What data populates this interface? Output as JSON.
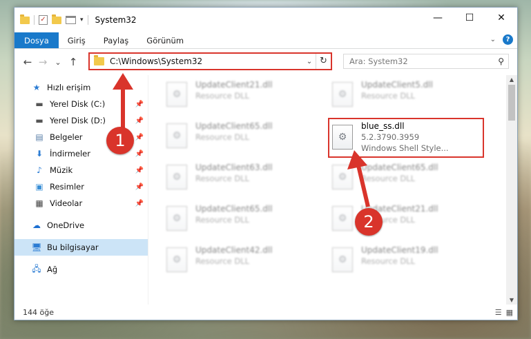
{
  "window": {
    "title": "System32",
    "controls": {
      "minimize": "—",
      "maximize": "☐",
      "close": "✕"
    }
  },
  "ribbon": {
    "tabs": [
      "Dosya",
      "Giriş",
      "Paylaş",
      "Görünüm"
    ],
    "help": "?"
  },
  "nav": {
    "back": "←",
    "forward": "→",
    "recent": "⌄",
    "up": "↑",
    "address": "C:\\Windows\\System32",
    "search_placeholder": "Ara: System32"
  },
  "sidebar": {
    "quick_access": "Hızlı erişim",
    "items": [
      {
        "label": "Yerel Disk (C:)",
        "icon": "drive-icon"
      },
      {
        "label": "Yerel Disk (D:)",
        "icon": "drive-icon"
      },
      {
        "label": "Belgeler",
        "icon": "documents-icon"
      },
      {
        "label": "İndirmeler",
        "icon": "downloads-icon"
      },
      {
        "label": "Müzik",
        "icon": "music-icon"
      },
      {
        "label": "Resimler",
        "icon": "pictures-icon"
      },
      {
        "label": "Videolar",
        "icon": "videos-icon"
      }
    ],
    "onedrive": "OneDrive",
    "this_pc": "Bu bilgisayar",
    "network": "Ağ"
  },
  "files": {
    "left_column": [
      {
        "name": "UpdateClient21.dll",
        "type": "Resource DLL"
      },
      {
        "name": "UpdateClient65.dll",
        "type": "Resource DLL"
      },
      {
        "name": "UpdateClient63.dll",
        "type": "Resource DLL"
      },
      {
        "name": "UpdateClient65.dll",
        "type": "Resource DLL"
      },
      {
        "name": "UpdateClient42.dll",
        "type": "Resource DLL"
      }
    ],
    "right_column": [
      {
        "name": "UpdateClient5.dll",
        "type": "Resource DLL"
      },
      {
        "name": "blue_ss.dll",
        "version": "5.2.3790.3959",
        "type": "Windows Shell Style..."
      },
      {
        "name": "UpdateClient65.dll",
        "type": "Resource DLL"
      },
      {
        "name": "UpdateClient21.dll",
        "type": "Resource DLL"
      },
      {
        "name": "UpdateClient19.dll",
        "type": "Resource DLL"
      }
    ]
  },
  "status": {
    "count": "144 öğe"
  },
  "annotations": {
    "step1": "1",
    "step2": "2",
    "color": "#d9342b"
  }
}
